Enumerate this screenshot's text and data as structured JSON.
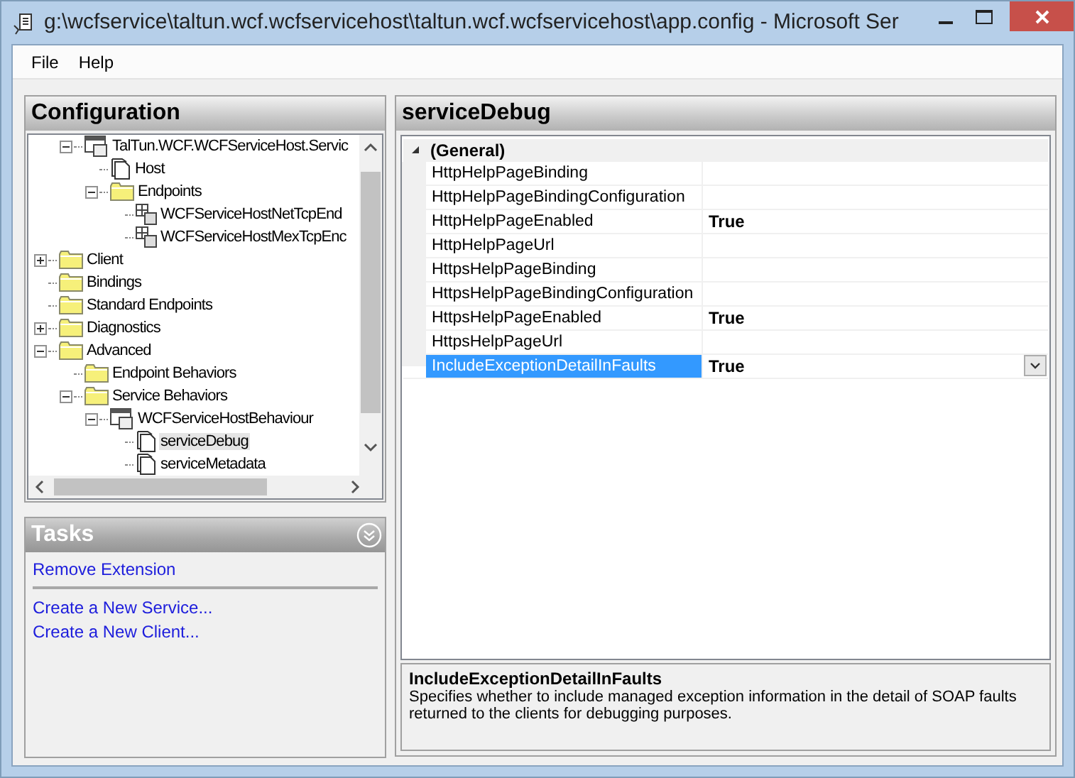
{
  "window": {
    "title": "g:\\wcfservice\\taltun.wcf.wcfservicehost\\taltun.wcf.wcfservicehost\\app.config - Microsoft Ser"
  },
  "menu": [
    {
      "label": "File"
    },
    {
      "label": "Help"
    }
  ],
  "configuration": {
    "title": "Configuration",
    "tree": {
      "continued_items": [
        {
          "label": "TalTun.WCF.WCFServiceHost.Servic",
          "kind": "service",
          "expanded": true,
          "selected": false,
          "children": [
            {
              "label": "Host",
              "kind": "file",
              "selected": false
            },
            {
              "label": "Endpoints",
              "kind": "folder",
              "expanded": true,
              "selected": false,
              "children": [
                {
                  "label": "WCFServiceHostNetTcpEnd",
                  "kind": "endpoint",
                  "selected": false
                },
                {
                  "label": "WCFServiceHostMexTcpEnc",
                  "kind": "endpoint",
                  "selected": false
                }
              ]
            }
          ]
        }
      ],
      "items": [
        {
          "label": "Client",
          "kind": "folder",
          "expanded": false,
          "selected": false
        },
        {
          "label": "Bindings",
          "kind": "folder",
          "selected": false
        },
        {
          "label": "Standard Endpoints",
          "kind": "folder",
          "selected": false
        },
        {
          "label": "Diagnostics",
          "kind": "folder",
          "expanded": false,
          "selected": false
        },
        {
          "label": "Advanced",
          "kind": "folder",
          "expanded": true,
          "selected": false,
          "children": [
            {
              "label": "Endpoint Behaviors",
              "kind": "folder",
              "selected": false
            },
            {
              "label": "Service Behaviors",
              "kind": "folder",
              "expanded": true,
              "selected": false,
              "children": [
                {
                  "label": "WCFServiceHostBehaviour",
                  "kind": "service",
                  "expanded": true,
                  "selected": false,
                  "children": [
                    {
                      "label": "serviceDebug",
                      "kind": "file",
                      "selected": true
                    },
                    {
                      "label": "serviceMetadata",
                      "kind": "file",
                      "selected": false
                    }
                  ]
                }
              ]
            }
          ]
        }
      ]
    }
  },
  "tasks": {
    "title": "Tasks",
    "groups": [
      [
        "Remove Extension"
      ],
      [
        "Create a New Service...",
        "Create a New Client..."
      ]
    ]
  },
  "editor": {
    "title": "serviceDebug",
    "category": {
      "label": "(General)",
      "expanded": true
    },
    "properties": [
      {
        "name": "HttpHelpPageBinding",
        "selected": false
      },
      {
        "name": "HttpHelpPageBindingConfiguration",
        "selected": false
      },
      {
        "name": "HttpHelpPageEnabled",
        "value": "True",
        "selected": false
      },
      {
        "name": "HttpHelpPageUrl",
        "selected": false
      },
      {
        "name": "HttpsHelpPageBinding",
        "selected": false
      },
      {
        "name": "HttpsHelpPageBindingConfiguration",
        "selected": false
      },
      {
        "name": "HttpsHelpPageEnabled",
        "value": "True",
        "selected": false
      },
      {
        "name": "HttpsHelpPageUrl",
        "selected": false
      },
      {
        "name": "IncludeExceptionDetailInFaults",
        "value": "True",
        "selected": true
      }
    ],
    "description": {
      "title": "IncludeExceptionDetailInFaults",
      "text": "Specifies whether to include managed exception information in the detail of SOAP faults returned to the clients for debugging purposes."
    }
  }
}
